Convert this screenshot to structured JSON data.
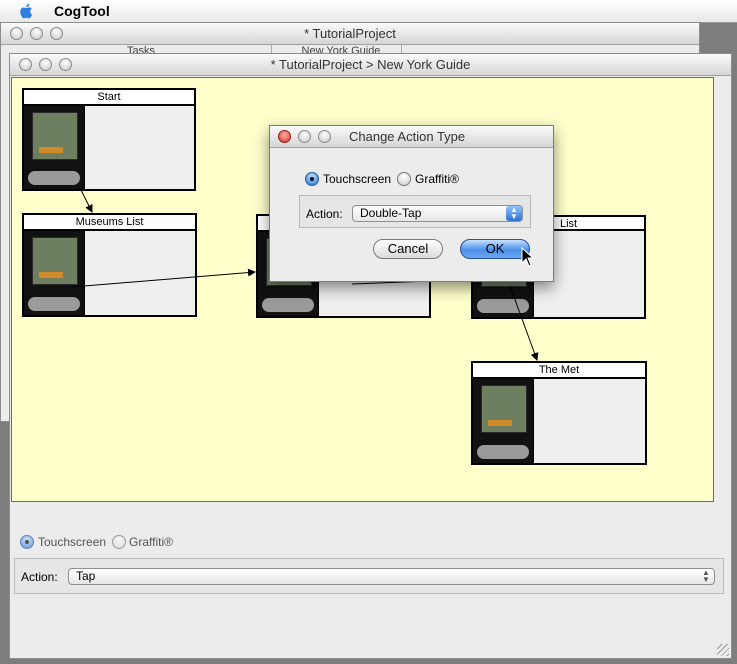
{
  "menubar": {
    "app_name": "CogTool"
  },
  "back_window": {
    "title": "* TutorialProject",
    "columns": [
      "Tasks",
      "New York Guide"
    ]
  },
  "main_window": {
    "title": "* TutorialProject > New York Guide",
    "frames": [
      {
        "name": "Start"
      },
      {
        "name": "Museums List"
      },
      {
        "name": ""
      },
      {
        "name": "List"
      },
      {
        "name": "The Met"
      }
    ],
    "bottom_panel": {
      "radio_touchscreen": "Touchscreen",
      "radio_graffiti": "Graffiti®",
      "action_label": "Action:",
      "action_value": "Tap"
    }
  },
  "dialog": {
    "title": "Change Action Type",
    "radio_touchscreen": "Touchscreen",
    "radio_graffiti": "Graffiti®",
    "selected_mode": "Touchscreen",
    "action_label": "Action:",
    "action_value": "Double-Tap",
    "cancel_label": "Cancel",
    "ok_label": "OK"
  }
}
